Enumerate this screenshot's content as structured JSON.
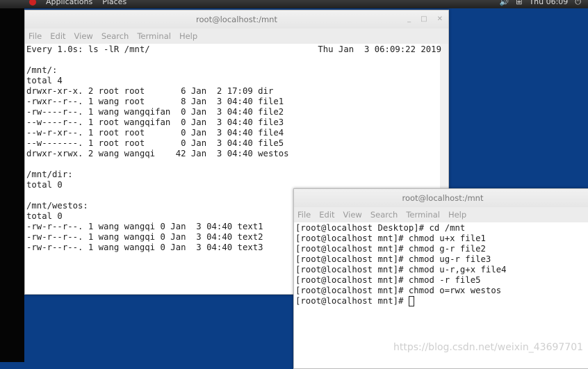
{
  "topbar": {
    "applications": "Applications",
    "places": "Places",
    "clock": "Thu 06:09"
  },
  "window1": {
    "title": "root@localhost:/mnt",
    "menu": [
      "File",
      "Edit",
      "View",
      "Search",
      "Terminal",
      "Help"
    ],
    "header_left": "Every 1.0s: ls -lR /mnt/",
    "header_right": "Thu Jan  3 06:09:22 2019",
    "lines": [
      "",
      "/mnt/:",
      "total 4",
      "drwxr-xr-x. 2 root root       6 Jan  2 17:09 dir",
      "-rwxr--r--. 1 wang root       8 Jan  3 04:40 file1",
      "-rw----r--. 1 wang wangqifan  0 Jan  3 04:40 file2",
      "--w----r--. 1 root wangqifan  0 Jan  3 04:40 file3",
      "--w-r-xr--. 1 root root       0 Jan  3 04:40 file4",
      "--w-------. 1 root root       0 Jan  3 04:40 file5",
      "drwxr-xrwx. 2 wang wangqi    42 Jan  3 04:40 westos",
      "",
      "/mnt/dir:",
      "total 0",
      "",
      "/mnt/westos:",
      "total 0",
      "-rw-r--r--. 1 wang wangqi 0 Jan  3 04:40 text1",
      "-rw-r--r--. 1 wang wangqi 0 Jan  3 04:40 text2",
      "-rw-r--r--. 1 wang wangqi 0 Jan  3 04:40 text3"
    ]
  },
  "window2": {
    "title": "root@localhost:/mnt",
    "menu": [
      "File",
      "Edit",
      "View",
      "Search",
      "Terminal",
      "Help"
    ],
    "lines": [
      "[root@localhost Desktop]# cd /mnt",
      "[root@localhost mnt]# chmod u+x file1",
      "[root@localhost mnt]# chmod g-r file2",
      "[root@localhost mnt]# chmod ug-r file3",
      "[root@localhost mnt]# chmod u-r,g+x file4",
      "[root@localhost mnt]# chmod -r file5",
      "[root@localhost mnt]# chmod o=rwx westos"
    ],
    "prompt": "[root@localhost mnt]# "
  },
  "watermark": "https://blog.csdn.net/weixin_43697701"
}
